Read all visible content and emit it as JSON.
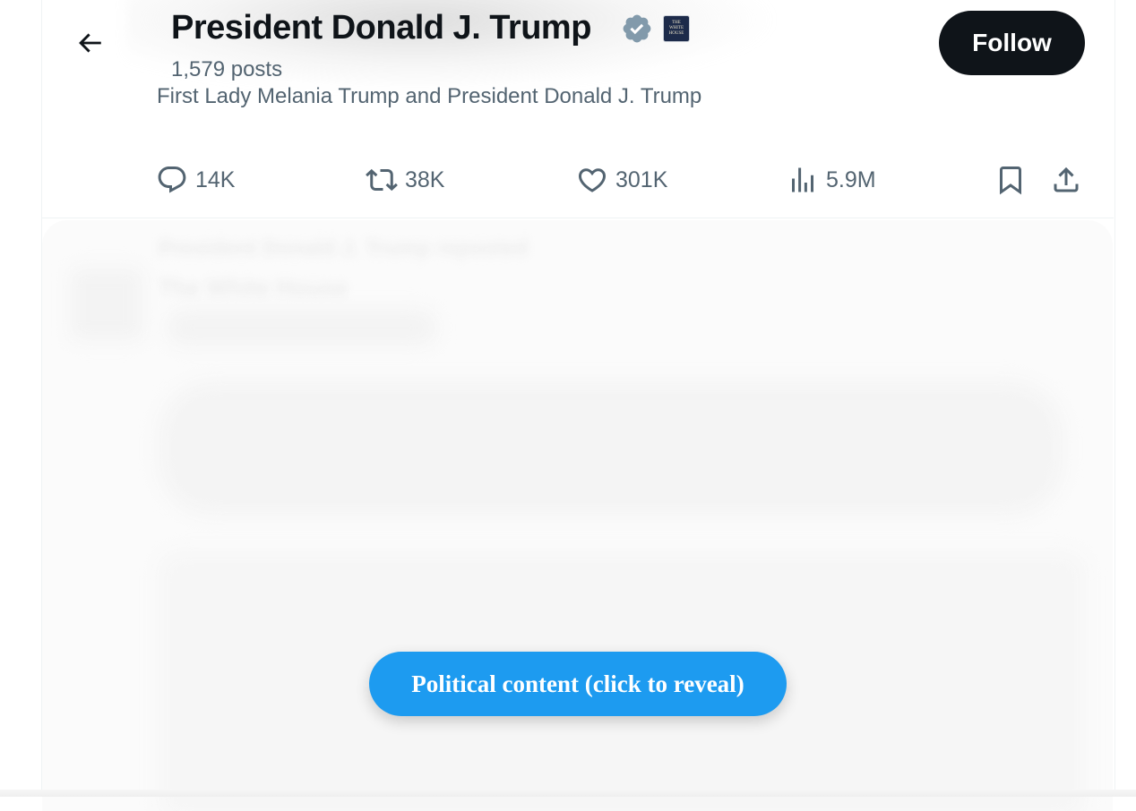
{
  "header": {
    "profile_name": "President Donald J. Trump",
    "posts_count": "1,579 posts",
    "affiliate_badge_text": "THE WHITE HOUSE",
    "follow_label": "Follow"
  },
  "tweet": {
    "caption": "First Lady Melania Trump and President Donald J. Trump",
    "actions": {
      "replies": "14K",
      "retweets": "38K",
      "likes": "301K",
      "views": "5.9M"
    }
  },
  "blurred_next": {
    "retweeted_by": "President Donald J. Trump reposted",
    "author": "The White House",
    "reveal_label": "Political content (click to reveal)"
  },
  "icons": [
    "back-arrow-icon",
    "verified-icon",
    "affiliate-badge-icon",
    "reply-icon",
    "retweet-icon",
    "like-icon",
    "views-icon",
    "bookmark-icon",
    "share-icon"
  ],
  "colors": {
    "accent": "#1d9bf0",
    "text_primary": "#0f1419",
    "text_secondary": "#536471",
    "verified_badge": "#829aab"
  }
}
